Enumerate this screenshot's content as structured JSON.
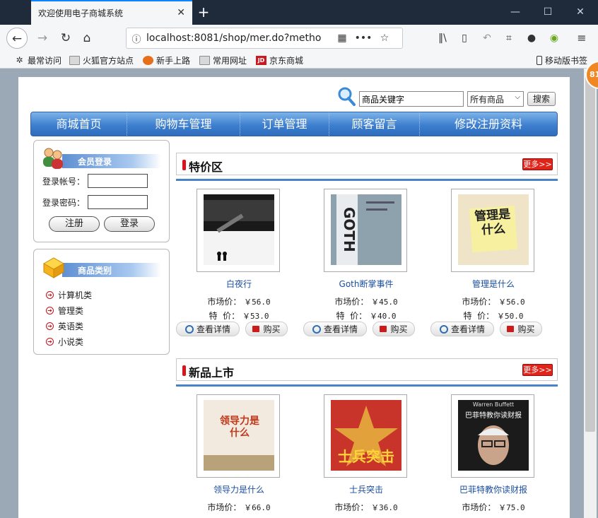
{
  "browser": {
    "tab_title": "欢迎使用电子商城系统",
    "url": "localhost:8081/shop/mer.do?metho",
    "bookmarks": [
      "最常访问",
      "火狐官方站点",
      "新手上路",
      "常用网址",
      "京东商城"
    ],
    "mobile_bookmarks": "移动版书签",
    "badge": "81"
  },
  "header": {
    "search_placeholder": "商品关键字",
    "category_select": "所有商品",
    "search_button": "搜索"
  },
  "nav": [
    "商城首页",
    "购物车管理",
    "订单管理",
    "顾客留言",
    "修改注册资料"
  ],
  "login": {
    "title": "会员登录",
    "account_label": "登录帐号：",
    "password_label": "登录密码：",
    "register": "注册",
    "login": "登录"
  },
  "categories": {
    "title": "商品类别",
    "items": [
      "计算机类",
      "管理类",
      "英语类",
      "小说类"
    ]
  },
  "labels": {
    "market_price": "市场价：",
    "special_price": "特  价：",
    "detail": "查看详情",
    "buy": "购买",
    "more": "更多>>"
  },
  "special": {
    "title": "特价区",
    "products": [
      {
        "name": "白夜行",
        "market": "￥56.0",
        "special": "￥53.0"
      },
      {
        "name": "Goth断掌事件",
        "market": "￥45.0",
        "special": "￥40.0"
      },
      {
        "name": "管理是什么",
        "market": "￥56.0",
        "special": "￥50.0"
      }
    ]
  },
  "new": {
    "title": "新品上市",
    "products": [
      {
        "name": "领导力是什么",
        "market": "￥66.0"
      },
      {
        "name": "士兵突击",
        "market": "￥36.0"
      },
      {
        "name": "巴菲特教你读财报",
        "market": "￥75.0"
      }
    ]
  },
  "covers": {
    "goth": "GOTH",
    "mgmt": "管理是什么",
    "lead": "领导力是什么",
    "soldier": "士兵突击",
    "buffett": "巴菲特教你读财报",
    "buffett_name": "Warren Buffett"
  }
}
